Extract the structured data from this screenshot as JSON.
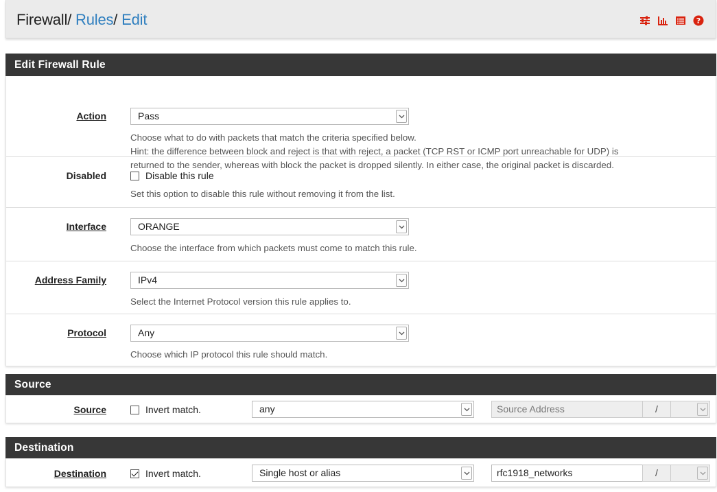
{
  "breadcrumb": {
    "part1": "Firewall",
    "sep1": "/",
    "part2": "Rules",
    "sep2": "/",
    "part3": "Edit"
  },
  "header_icons": [
    "sliders-icon",
    "bar-chart-icon",
    "list-icon",
    "help-icon"
  ],
  "colors": {
    "link": "#2f7fbf",
    "panel_header": "#373737",
    "icon_red": "#d9230f"
  },
  "edit_panel": {
    "title": "Edit Firewall Rule",
    "action": {
      "label": "Action",
      "value": "Pass",
      "help1": "Choose what to do with packets that match the criteria specified below.",
      "help2": "Hint: the difference between block and reject is that with reject, a packet (TCP RST or ICMP port unreachable for UDP) is",
      "help3": "returned to the sender, whereas with block the packet is dropped silently. In either case, the original packet is discarded."
    },
    "disabled": {
      "label": "Disabled",
      "checkbox_label": "Disable this rule",
      "checked": false,
      "help": "Set this option to disable this rule without removing it from the list."
    },
    "interface": {
      "label": "Interface",
      "value": "ORANGE",
      "help": "Choose the interface from which packets must come to match this rule."
    },
    "address_family": {
      "label": "Address Family",
      "value": "IPv4",
      "help": "Select the Internet Protocol version this rule applies to."
    },
    "protocol": {
      "label": "Protocol",
      "value": "Any",
      "help": "Choose which IP protocol this rule should match."
    }
  },
  "source_panel": {
    "title": "Source",
    "label": "Source",
    "invert_label": "Invert match.",
    "invert_checked": false,
    "type_value": "any",
    "address_placeholder": "Source Address",
    "slash": "/"
  },
  "destination_panel": {
    "title": "Destination",
    "label": "Destination",
    "invert_label": "Invert match.",
    "invert_checked": true,
    "type_value": "Single host or alias",
    "address_value": "rfc1918_networks",
    "slash": "/"
  }
}
